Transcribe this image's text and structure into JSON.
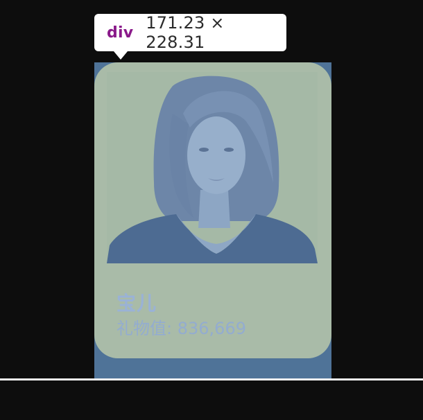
{
  "tooltip": {
    "tag": "div",
    "size": "171.23 × 228.31"
  },
  "card": {
    "name": "宝儿",
    "gift_label": "礼物值: 836,669"
  },
  "colors": {
    "background": "#0d0d0d",
    "overlay": "#4f7398",
    "card": "#a9bba8",
    "name_text": "#9ab2d6"
  }
}
